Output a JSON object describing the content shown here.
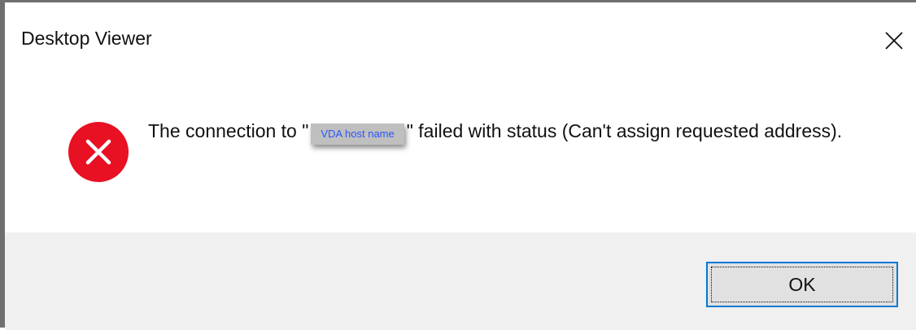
{
  "dialog": {
    "title": "Desktop Viewer",
    "message_before": "The connection to \"",
    "host_placeholder": "VDA host name",
    "message_after": "\" failed with status (Can't assign requested address).",
    "ok_label": "OK"
  },
  "icons": {
    "status": "error-icon",
    "close": "close-icon"
  },
  "colors": {
    "error_red": "#e81123",
    "accent_border": "#0078d7",
    "footer_bg": "#f0f0f0"
  }
}
